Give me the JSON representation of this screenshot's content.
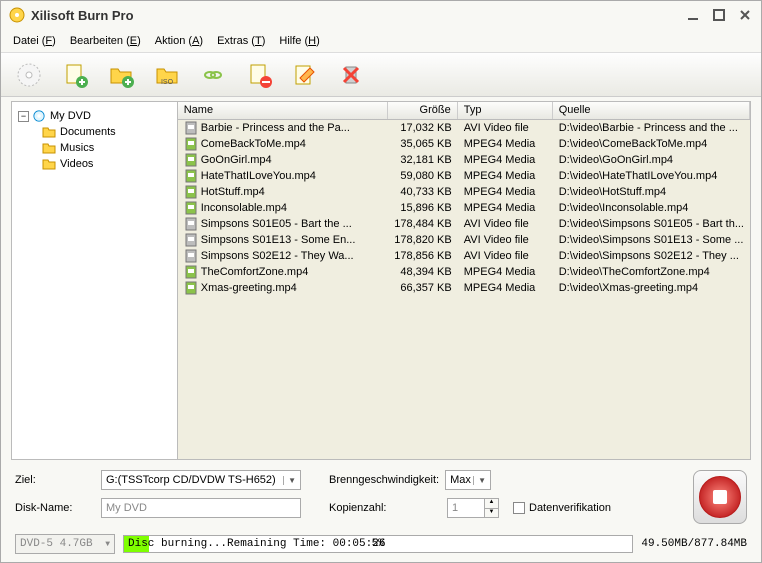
{
  "app": {
    "title": "Xilisoft Burn Pro"
  },
  "menu": {
    "file": "Datei (F)",
    "edit": "Bearbeiten (E)",
    "action": "Aktion (A)",
    "extras": "Extras (T)",
    "help": "Hilfe (H)"
  },
  "tree": {
    "root": "My DVD",
    "items": [
      "Documents",
      "Musics",
      "Videos"
    ]
  },
  "columns": {
    "name": "Name",
    "size": "Größe",
    "type": "Typ",
    "source": "Quelle"
  },
  "files": [
    {
      "icon": "avi",
      "name": "Barbie - Princess and the Pa...",
      "size": "17,032 KB",
      "type": "AVI Video file",
      "src": "D:\\video\\Barbie - Princess and the ..."
    },
    {
      "icon": "mp4",
      "name": "ComeBackToMe.mp4",
      "size": "35,065 KB",
      "type": "MPEG4 Media",
      "src": "D:\\video\\ComeBackToMe.mp4"
    },
    {
      "icon": "mp4",
      "name": "GoOnGirl.mp4",
      "size": "32,181 KB",
      "type": "MPEG4 Media",
      "src": "D:\\video\\GoOnGirl.mp4"
    },
    {
      "icon": "mp4",
      "name": "HateThatILoveYou.mp4",
      "size": "59,080 KB",
      "type": "MPEG4 Media",
      "src": "D:\\video\\HateThatILoveYou.mp4"
    },
    {
      "icon": "mp4",
      "name": "HotStuff.mp4",
      "size": "40,733 KB",
      "type": "MPEG4 Media",
      "src": "D:\\video\\HotStuff.mp4"
    },
    {
      "icon": "mp4",
      "name": "Inconsolable.mp4",
      "size": "15,896 KB",
      "type": "MPEG4 Media",
      "src": "D:\\video\\Inconsolable.mp4"
    },
    {
      "icon": "avi",
      "name": "Simpsons S01E05 - Bart the ...",
      "size": "178,484 KB",
      "type": "AVI Video file",
      "src": "D:\\video\\Simpsons S01E05 - Bart th..."
    },
    {
      "icon": "avi",
      "name": "Simpsons S01E13 - Some En...",
      "size": "178,820 KB",
      "type": "AVI Video file",
      "src": "D:\\video\\Simpsons S01E13 - Some ..."
    },
    {
      "icon": "avi",
      "name": "Simpsons S02E12 - They Wa...",
      "size": "178,856 KB",
      "type": "AVI Video file",
      "src": "D:\\video\\Simpsons S02E12 - They ..."
    },
    {
      "icon": "mp4",
      "name": "TheComfortZone.mp4",
      "size": "48,394 KB",
      "type": "MPEG4 Media",
      "src": "D:\\video\\TheComfortZone.mp4"
    },
    {
      "icon": "mp4",
      "name": "Xmas-greeting.mp4",
      "size": "66,357 KB",
      "type": "MPEG4 Media",
      "src": "D:\\video\\Xmas-greeting.mp4"
    }
  ],
  "form": {
    "target_label": "Ziel:",
    "target_value": "G:(TSSTcorp CD/DVDW TS-H652)",
    "disc_name_label": "Disk-Name:",
    "disc_name_value": "My DVD",
    "speed_label": "Brenngeschwindigkeit:",
    "speed_value": "Max",
    "copies_label": "Kopienzahl:",
    "copies_value": "1",
    "verify_label": "Datenverifikation"
  },
  "status": {
    "media": "DVD-5 4.7GB",
    "text": "Disc burning...Remaining Time: 00:05:26",
    "percent": "5%",
    "size": "49.50MB/877.84MB"
  }
}
